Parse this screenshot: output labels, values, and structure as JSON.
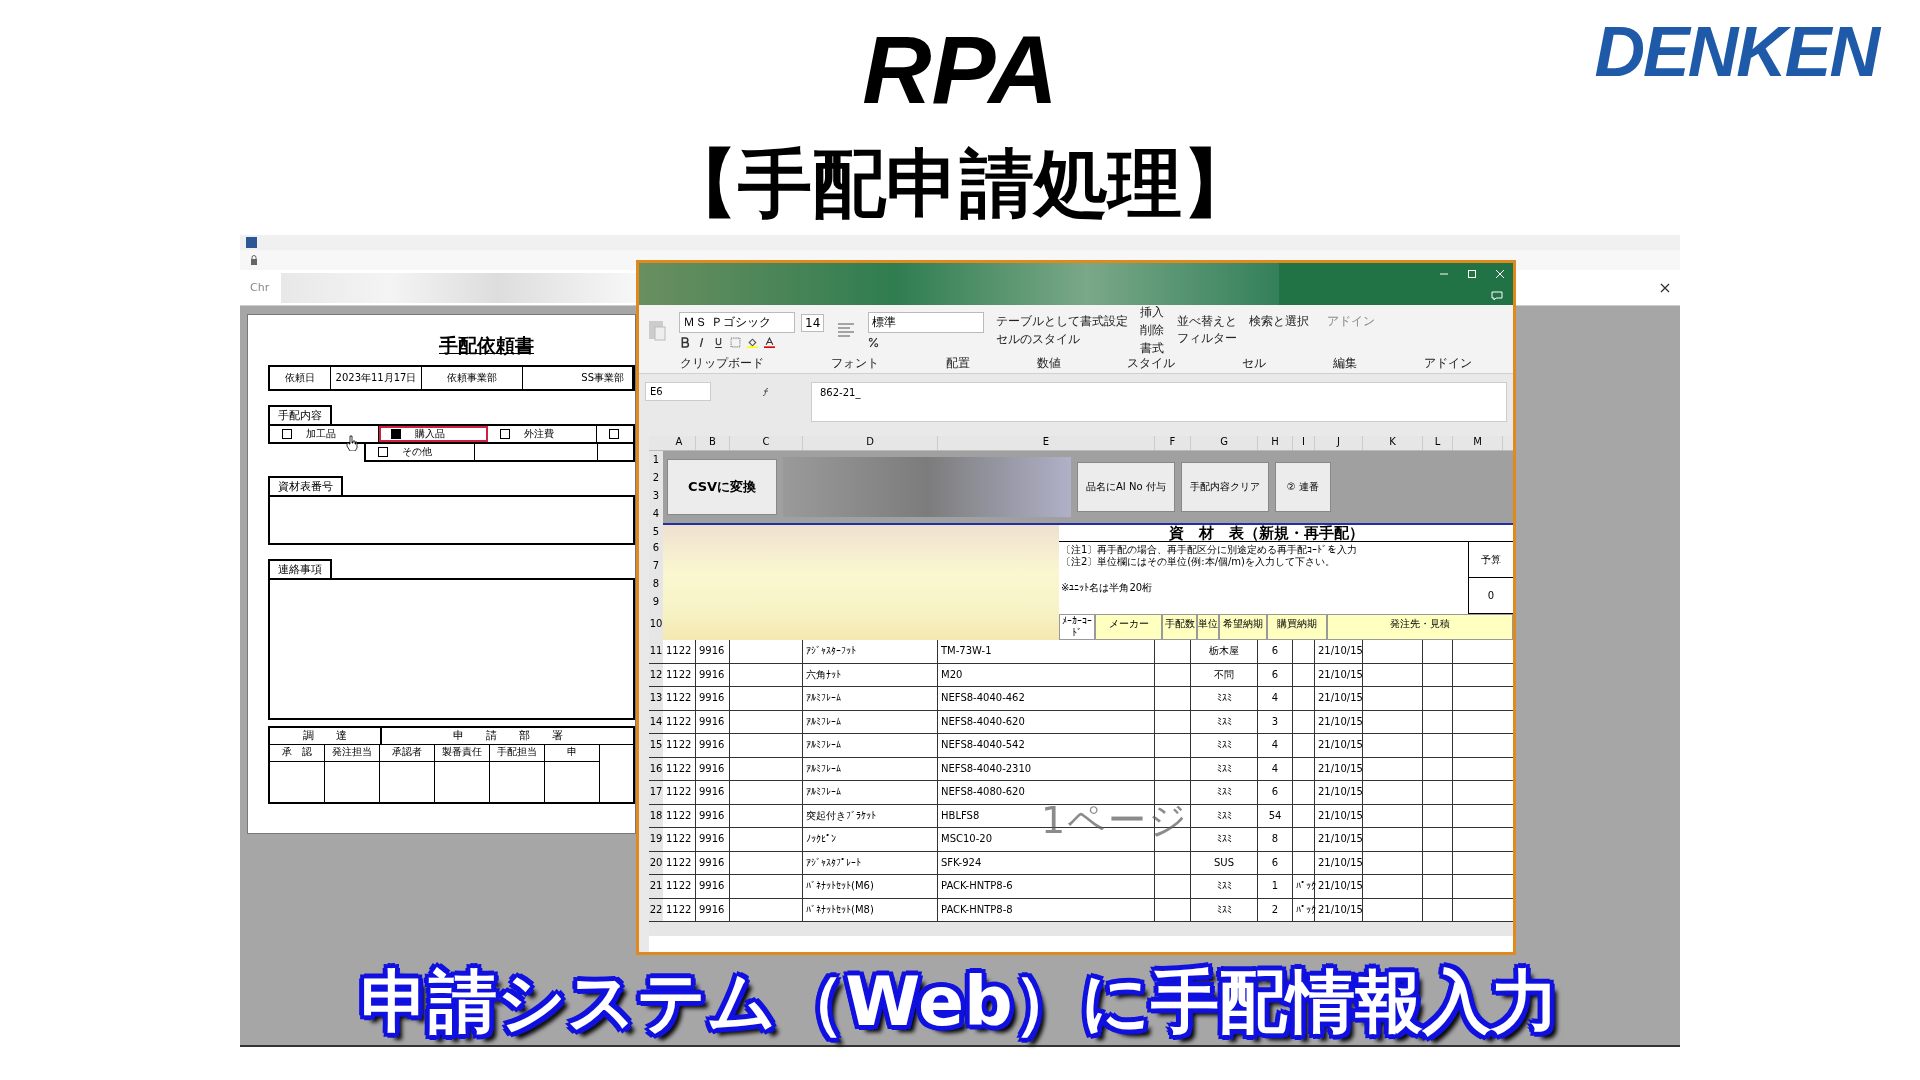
{
  "slide": {
    "title": "RPA",
    "subtitle": "【手配申請処理】",
    "logo": "DENKEN",
    "caption": "申請システム（Web）に手配情報入力"
  },
  "browser": {
    "tab_label": "Chr"
  },
  "form": {
    "title": "手配依頼書",
    "date_label": "依頼日",
    "date": "2023年11月17日",
    "dept_label": "依頼事業部",
    "dept": "SS事業部",
    "content_label": "手配内容",
    "options": [
      {
        "label": "加工品",
        "checked": false,
        "focused": false
      },
      {
        "label": "購入品",
        "checked": true,
        "focused": true
      },
      {
        "label": "外注費",
        "checked": false,
        "focused": false
      },
      {
        "checked": false,
        "focused": false
      },
      {
        "label": "その他",
        "checked": false,
        "focused": false
      }
    ],
    "material_label": "資材表番号",
    "notes_label": "連絡事項",
    "group1": "調　　達",
    "group2": "申　　請　　部　　署",
    "approval_columns": [
      "承　認",
      "発注担当",
      "承認者",
      "製番責任",
      "手配担当",
      "申"
    ]
  },
  "excel": {
    "font_name": "ＭＳ Ｐゴシック",
    "font_size": "14",
    "number_format": "標準",
    "ribbon_items": [
      "テーブルとして書式設定",
      "セルのスタイル",
      "挿入",
      "削除",
      "書式",
      "並べ替えとフィルター",
      "検索と選択",
      "アドイン"
    ],
    "ribbon_groups": [
      "クリップボード",
      "フォント",
      "配置",
      "数値",
      "スタイル",
      "セル",
      "編集",
      "アドイン"
    ],
    "name_box": "E6",
    "formula": "862-21_",
    "columns": [
      "A",
      "B",
      "C",
      "D",
      "E",
      "F",
      "G",
      "H",
      "I",
      "J",
      "K",
      "L",
      "M"
    ],
    "header_rows": [
      "1",
      "2",
      "3",
      "4",
      "5",
      "6",
      "7",
      "8",
      "9",
      "10"
    ],
    "buttons": [
      "CSVに変換",
      "品名にAI No 付与",
      "手配内容クリア",
      "② 連番"
    ],
    "sheet_title": "資　材　表（新規・再手配）",
    "notes": [
      "〔注1〕再手配の場合、再手配区分に別途定める再手配ｺｰﾄﾞを入力",
      "〔注2〕単位欄にはその単位(例:本/個/m)を入力して下さい。",
      "※ﾕﾆｯﾄ名は半角20桁"
    ],
    "budget_label": "予算",
    "budget": "0",
    "headers": [
      "ﾒｰｶｰｺｰﾄﾞ",
      "メーカー",
      "手配数",
      "単位",
      "希望納期",
      "購買納期",
      "発注先・見積"
    ],
    "rows": [
      {
        "n": "11",
        "a": "1122",
        "b": "9916",
        "d": "ｱｼﾞｬｽﾀｰﾌｯﾄ",
        "e": "TM-73W-1",
        "g": "栃木屋",
        "h": "6",
        "j": "21/10/15"
      },
      {
        "n": "12",
        "a": "1122",
        "b": "9916",
        "d": "六角ﾅｯﾄ",
        "e": "M20",
        "g": "不問",
        "h": "6",
        "j": "21/10/15"
      },
      {
        "n": "13",
        "a": "1122",
        "b": "9916",
        "d": "ｱﾙﾐﾌﾚｰﾑ",
        "e": "NEFS8-4040-462",
        "g": "ﾐｽﾐ",
        "h": "4",
        "j": "21/10/15"
      },
      {
        "n": "14",
        "a": "1122",
        "b": "9916",
        "d": "ｱﾙﾐﾌﾚｰﾑ",
        "e": "NEFS8-4040-620",
        "g": "ﾐｽﾐ",
        "h": "3",
        "j": "21/10/15"
      },
      {
        "n": "15",
        "a": "1122",
        "b": "9916",
        "d": "ｱﾙﾐﾌﾚｰﾑ",
        "e": "NEFS8-4040-542",
        "g": "ﾐｽﾐ",
        "h": "4",
        "j": "21/10/15"
      },
      {
        "n": "16",
        "a": "1122",
        "b": "9916",
        "d": "ｱﾙﾐﾌﾚｰﾑ",
        "e": "NEFS8-4040-2310",
        "g": "ﾐｽﾐ",
        "h": "4",
        "j": "21/10/15"
      },
      {
        "n": "17",
        "a": "1122",
        "b": "9916",
        "d": "ｱﾙﾐﾌﾚｰﾑ",
        "e": "NEFS8-4080-620",
        "g": "ﾐｽﾐ",
        "h": "6",
        "j": "21/10/15"
      },
      {
        "n": "18",
        "a": "1122",
        "b": "9916",
        "d": "突起付きﾌﾞﾗｹｯﾄ",
        "e": "HBLFS8",
        "g": "ﾐｽﾐ",
        "h": "54",
        "j": "21/10/15"
      },
      {
        "n": "19",
        "a": "1122",
        "b": "9916",
        "d": "ﾉｯｸﾋﾟﾝ",
        "e": "MSC10-20",
        "g": "ﾐｽﾐ",
        "h": "8",
        "j": "21/10/15"
      },
      {
        "n": "20",
        "a": "1122",
        "b": "9916",
        "d": "ｱｼﾞｬｽﾀﾌﾟﾚｰﾄ",
        "e": "SFK-924",
        "g": "SUS",
        "h": "6",
        "j": "21/10/15"
      },
      {
        "n": "21",
        "a": "1122",
        "b": "9916",
        "d": "ﾊﾞﾈﾅｯﾄｾｯﾄ(M6)",
        "e": "PACK-HNTP8-6",
        "g": "ﾐｽﾐ",
        "h": "1",
        "i": "ﾊﾟｯｸ",
        "j": "21/10/15"
      },
      {
        "n": "22",
        "a": "1122",
        "b": "9916",
        "d": "ﾊﾞﾈﾅｯﾄｾｯﾄ(M8)",
        "e": "PACK-HNTP8-8",
        "g": "ﾐｽﾐ",
        "h": "2",
        "i": "ﾊﾟｯｸ",
        "j": "21/10/15"
      }
    ],
    "page_watermark": "1ページ"
  }
}
